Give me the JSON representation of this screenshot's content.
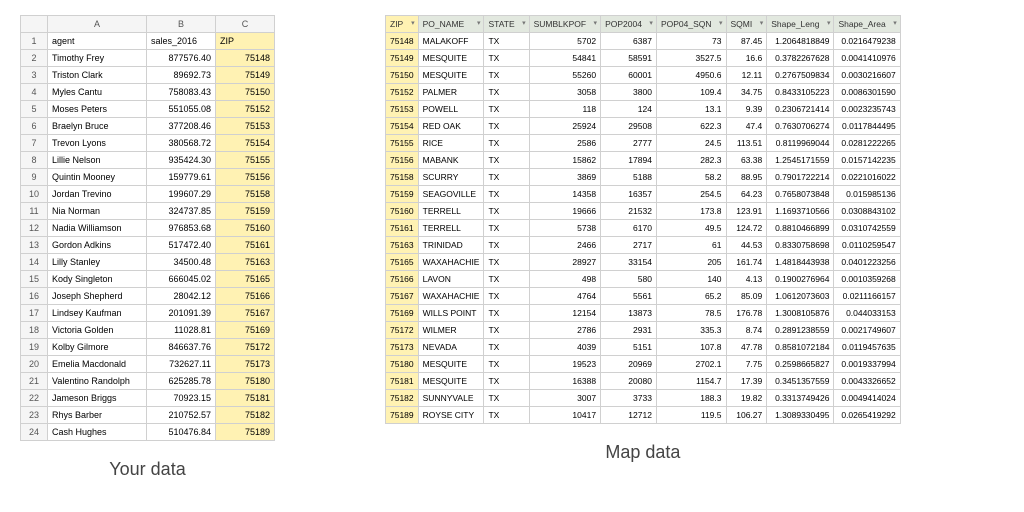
{
  "captions": {
    "left": "Your data",
    "right": "Map data"
  },
  "left": {
    "col_letters": [
      "A",
      "B",
      "C"
    ],
    "headers": [
      "agent",
      "sales_2016",
      "ZIP"
    ],
    "highlight_col": 2,
    "rows": [
      {
        "n": 2,
        "agent": "Timothy Frey",
        "sales": "877576.40",
        "zip": "75148"
      },
      {
        "n": 3,
        "agent": "Triston Clark",
        "sales": "89692.73",
        "zip": "75149"
      },
      {
        "n": 4,
        "agent": "Myles Cantu",
        "sales": "758083.43",
        "zip": "75150"
      },
      {
        "n": 5,
        "agent": "Moses Peters",
        "sales": "551055.08",
        "zip": "75152"
      },
      {
        "n": 6,
        "agent": "Braelyn Bruce",
        "sales": "377208.46",
        "zip": "75153"
      },
      {
        "n": 7,
        "agent": "Trevon Lyons",
        "sales": "380568.72",
        "zip": "75154"
      },
      {
        "n": 8,
        "agent": "Lillie Nelson",
        "sales": "935424.30",
        "zip": "75155"
      },
      {
        "n": 9,
        "agent": "Quintin Mooney",
        "sales": "159779.61",
        "zip": "75156"
      },
      {
        "n": 10,
        "agent": "Jordan Trevino",
        "sales": "199607.29",
        "zip": "75158"
      },
      {
        "n": 11,
        "agent": "Nia Norman",
        "sales": "324737.85",
        "zip": "75159"
      },
      {
        "n": 12,
        "agent": "Nadia Williamson",
        "sales": "976853.68",
        "zip": "75160"
      },
      {
        "n": 13,
        "agent": "Gordon Adkins",
        "sales": "517472.40",
        "zip": "75161"
      },
      {
        "n": 14,
        "agent": "Lilly Stanley",
        "sales": "34500.48",
        "zip": "75163"
      },
      {
        "n": 15,
        "agent": "Kody Singleton",
        "sales": "666045.02",
        "zip": "75165"
      },
      {
        "n": 16,
        "agent": "Joseph Shepherd",
        "sales": "28042.12",
        "zip": "75166"
      },
      {
        "n": 17,
        "agent": "Lindsey Kaufman",
        "sales": "201091.39",
        "zip": "75167"
      },
      {
        "n": 18,
        "agent": "Victoria Golden",
        "sales": "11028.81",
        "zip": "75169"
      },
      {
        "n": 19,
        "agent": "Kolby Gilmore",
        "sales": "846637.76",
        "zip": "75172"
      },
      {
        "n": 20,
        "agent": "Emelia Macdonald",
        "sales": "732627.11",
        "zip": "75173"
      },
      {
        "n": 21,
        "agent": "Valentino Randolph",
        "sales": "625285.78",
        "zip": "75180"
      },
      {
        "n": 22,
        "agent": "Jameson Briggs",
        "sales": "70923.15",
        "zip": "75181"
      },
      {
        "n": 23,
        "agent": "Rhys Barber",
        "sales": "210752.57",
        "zip": "75182"
      },
      {
        "n": 24,
        "agent": "Cash Hughes",
        "sales": "510476.84",
        "zip": "75189"
      }
    ]
  },
  "right": {
    "headers": [
      "ZIP",
      "PO_NAME",
      "STATE",
      "SUMBLKPOF",
      "POP2004",
      "POP04_SQN",
      "SQMI",
      "Shape_Leng",
      "Shape_Area"
    ],
    "highlight_col": 0,
    "rows": [
      {
        "zip": "75148",
        "po": "MALAKOFF",
        "st": "TX",
        "c3": "5702",
        "c4": "6387",
        "c5": "73",
        "c6": "87.45",
        "c7": "1.2064818849",
        "c8": "0.0216479238"
      },
      {
        "zip": "75149",
        "po": "MESQUITE",
        "st": "TX",
        "c3": "54841",
        "c4": "58591",
        "c5": "3527.5",
        "c6": "16.6",
        "c7": "0.3782267628",
        "c8": "0.0041410976"
      },
      {
        "zip": "75150",
        "po": "MESQUITE",
        "st": "TX",
        "c3": "55260",
        "c4": "60001",
        "c5": "4950.6",
        "c6": "12.11",
        "c7": "0.2767509834",
        "c8": "0.0030216607"
      },
      {
        "zip": "75152",
        "po": "PALMER",
        "st": "TX",
        "c3": "3058",
        "c4": "3800",
        "c5": "109.4",
        "c6": "34.75",
        "c7": "0.8433105223",
        "c8": "0.0086301590"
      },
      {
        "zip": "75153",
        "po": "POWELL",
        "st": "TX",
        "c3": "118",
        "c4": "124",
        "c5": "13.1",
        "c6": "9.39",
        "c7": "0.2306721414",
        "c8": "0.0023235743"
      },
      {
        "zip": "75154",
        "po": "RED OAK",
        "st": "TX",
        "c3": "25924",
        "c4": "29508",
        "c5": "622.3",
        "c6": "47.4",
        "c7": "0.7630706274",
        "c8": "0.0117844495"
      },
      {
        "zip": "75155",
        "po": "RICE",
        "st": "TX",
        "c3": "2586",
        "c4": "2777",
        "c5": "24.5",
        "c6": "113.51",
        "c7": "0.8119969044",
        "c8": "0.0281222265"
      },
      {
        "zip": "75156",
        "po": "MABANK",
        "st": "TX",
        "c3": "15862",
        "c4": "17894",
        "c5": "282.3",
        "c6": "63.38",
        "c7": "1.2545171559",
        "c8": "0.0157142235"
      },
      {
        "zip": "75158",
        "po": "SCURRY",
        "st": "TX",
        "c3": "3869",
        "c4": "5188",
        "c5": "58.2",
        "c6": "88.95",
        "c7": "0.7901722214",
        "c8": "0.0221016022"
      },
      {
        "zip": "75159",
        "po": "SEAGOVILLE",
        "st": "TX",
        "c3": "14358",
        "c4": "16357",
        "c5": "254.5",
        "c6": "64.23",
        "c7": "0.7658073848",
        "c8": "0.015985136"
      },
      {
        "zip": "75160",
        "po": "TERRELL",
        "st": "TX",
        "c3": "19666",
        "c4": "21532",
        "c5": "173.8",
        "c6": "123.91",
        "c7": "1.1693710566",
        "c8": "0.0308843102"
      },
      {
        "zip": "75161",
        "po": "TERRELL",
        "st": "TX",
        "c3": "5738",
        "c4": "6170",
        "c5": "49.5",
        "c6": "124.72",
        "c7": "0.8810466899",
        "c8": "0.0310742559"
      },
      {
        "zip": "75163",
        "po": "TRINIDAD",
        "st": "TX",
        "c3": "2466",
        "c4": "2717",
        "c5": "61",
        "c6": "44.53",
        "c7": "0.8330758698",
        "c8": "0.0110259547"
      },
      {
        "zip": "75165",
        "po": "WAXAHACHIE",
        "st": "TX",
        "c3": "28927",
        "c4": "33154",
        "c5": "205",
        "c6": "161.74",
        "c7": "1.4818443938",
        "c8": "0.0401223256"
      },
      {
        "zip": "75166",
        "po": "LAVON",
        "st": "TX",
        "c3": "498",
        "c4": "580",
        "c5": "140",
        "c6": "4.13",
        "c7": "0.1900276964",
        "c8": "0.0010359268"
      },
      {
        "zip": "75167",
        "po": "WAXAHACHIE",
        "st": "TX",
        "c3": "4764",
        "c4": "5561",
        "c5": "65.2",
        "c6": "85.09",
        "c7": "1.0612073603",
        "c8": "0.0211166157"
      },
      {
        "zip": "75169",
        "po": "WILLS POINT",
        "st": "TX",
        "c3": "12154",
        "c4": "13873",
        "c5": "78.5",
        "c6": "176.78",
        "c7": "1.3008105876",
        "c8": "0.044033153"
      },
      {
        "zip": "75172",
        "po": "WILMER",
        "st": "TX",
        "c3": "2786",
        "c4": "2931",
        "c5": "335.3",
        "c6": "8.74",
        "c7": "0.2891238559",
        "c8": "0.0021749607"
      },
      {
        "zip": "75173",
        "po": "NEVADA",
        "st": "TX",
        "c3": "4039",
        "c4": "5151",
        "c5": "107.8",
        "c6": "47.78",
        "c7": "0.8581072184",
        "c8": "0.0119457635"
      },
      {
        "zip": "75180",
        "po": "MESQUITE",
        "st": "TX",
        "c3": "19523",
        "c4": "20969",
        "c5": "2702.1",
        "c6": "7.75",
        "c7": "0.2598665827",
        "c8": "0.0019337994"
      },
      {
        "zip": "75181",
        "po": "MESQUITE",
        "st": "TX",
        "c3": "16388",
        "c4": "20080",
        "c5": "1154.7",
        "c6": "17.39",
        "c7": "0.3451357559",
        "c8": "0.0043326652"
      },
      {
        "zip": "75182",
        "po": "SUNNYVALE",
        "st": "TX",
        "c3": "3007",
        "c4": "3733",
        "c5": "188.3",
        "c6": "19.82",
        "c7": "0.3313749426",
        "c8": "0.0049414024"
      },
      {
        "zip": "75189",
        "po": "ROYSE CITY",
        "st": "TX",
        "c3": "10417",
        "c4": "12712",
        "c5": "119.5",
        "c6": "106.27",
        "c7": "1.3089330495",
        "c8": "0.0265419292"
      }
    ]
  }
}
